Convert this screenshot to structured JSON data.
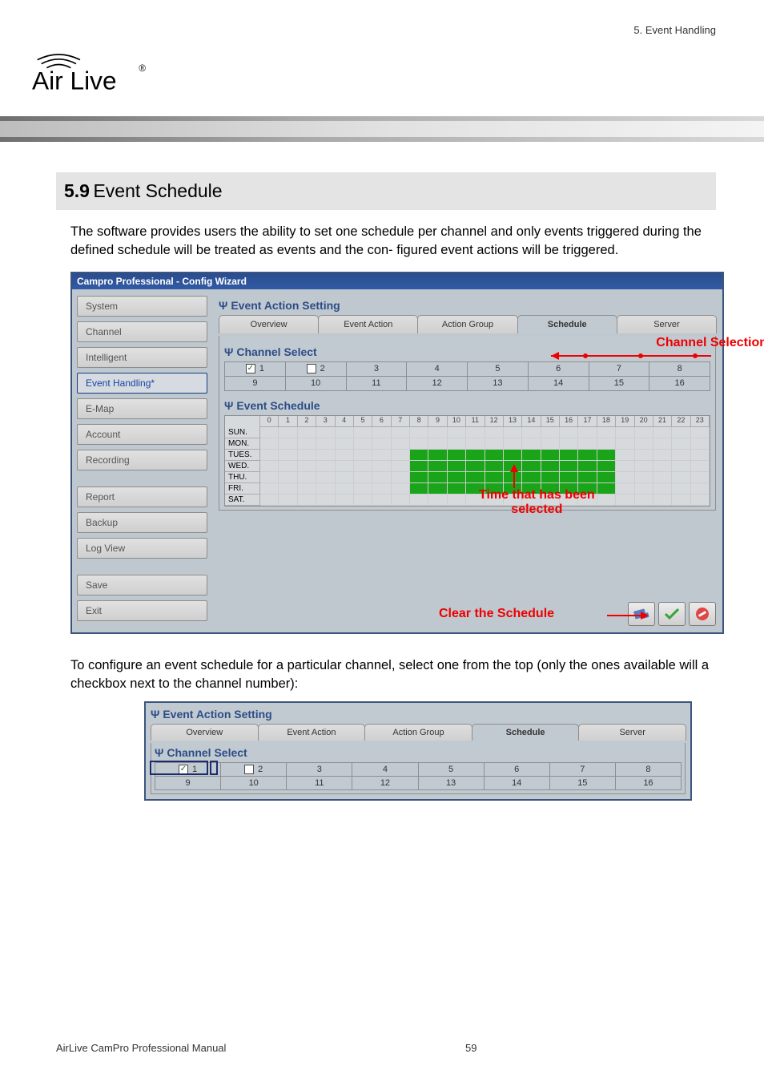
{
  "header_right": "5. Event Handling",
  "logo_text": "Air Live",
  "logo_reg": "®",
  "section_number": "5.9",
  "section_title": "Event Schedule",
  "intro_para": "The software provides users the ability to set one schedule per channel and only events triggered during the defined schedule will be treated as events and the con- figured event actions will be triggered.",
  "app_title": "Campro Professional - Config Wizard",
  "sidebar": {
    "items": [
      {
        "label": "System"
      },
      {
        "label": "Channel"
      },
      {
        "label": "Intelligent"
      },
      {
        "label": "Event Handling*"
      },
      {
        "label": "E-Map"
      },
      {
        "label": "Account"
      },
      {
        "label": "Recording"
      }
    ],
    "items2": [
      {
        "label": "Report"
      },
      {
        "label": "Backup"
      },
      {
        "label": "Log View"
      }
    ],
    "items3": [
      {
        "label": "Save"
      },
      {
        "label": "Exit"
      }
    ],
    "selected": "Event Handling*"
  },
  "content_heads": {
    "event_action_setting": "Event Action Setting",
    "channel_select": "Channel Select",
    "event_schedule": "Event Schedule"
  },
  "psi_icon": "Ψ",
  "tabs": [
    "Overview",
    "Event Action",
    "Action Group",
    "Schedule",
    "Server"
  ],
  "active_tab": "Schedule",
  "channels_row1": [
    "1",
    "2",
    "3",
    "4",
    "5",
    "6",
    "7",
    "8"
  ],
  "channels_row2": [
    "9",
    "10",
    "11",
    "12",
    "13",
    "14",
    "15",
    "16"
  ],
  "hours": [
    "0",
    "1",
    "2",
    "3",
    "4",
    "5",
    "6",
    "7",
    "8",
    "9",
    "10",
    "11",
    "12",
    "13",
    "14",
    "15",
    "16",
    "17",
    "18",
    "19",
    "20",
    "21",
    "22",
    "23"
  ],
  "days": [
    "SUN.",
    "MON.",
    "TUES.",
    "WED.",
    "THU.",
    "FRI.",
    "SAT."
  ],
  "annotations": {
    "channel_selection": "Channel Selection",
    "time_selected_1": "Time that has been",
    "time_selected_2": "selected",
    "clear_schedule": "Clear the Schedule"
  },
  "para2": "To configure an event schedule for a particular channel, select one from the top (only the ones available will a checkbox next to the channel number):",
  "footer_left": "AirLive CamPro Professional Manual",
  "footer_page": "59"
}
